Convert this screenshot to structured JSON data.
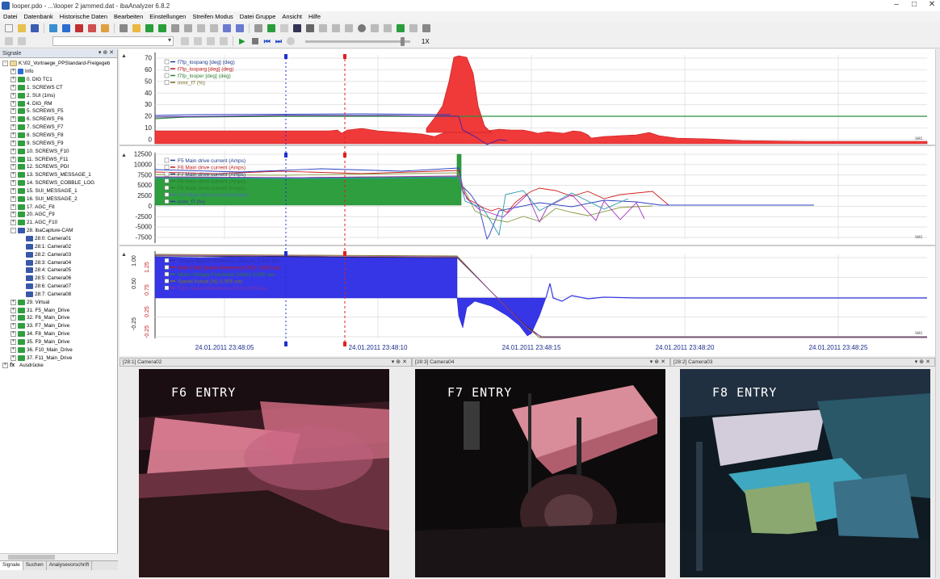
{
  "window": {
    "title": "looper.pdo - ...\\looper 2 jammed.dat - ibaAnalyzer 6.8.2",
    "min_icon": "minimize-icon",
    "max_icon": "maximize-icon",
    "close_icon": "close-icon",
    "min_glyph": "–",
    "max_glyph": "□",
    "close_glyph": "✕"
  },
  "menu": [
    "Datei",
    "Datenbank",
    "Historische Daten",
    "Bearbeiten",
    "Einstellungen",
    "Streifen Modus",
    "Datei Gruppe",
    "Ansicht",
    "Hilfe"
  ],
  "playback": {
    "speed": "1X"
  },
  "signals_panel": {
    "title": "Signale",
    "pin_glyph": "▾ ⊕ ✕",
    "tree": [
      {
        "label": "K:\\02_Vortraege_PPStandard-Freigegeb",
        "level": 0,
        "icon": "file",
        "exp": "-"
      },
      {
        "label": "Info",
        "level": 1,
        "icon": "info",
        "exp": "+"
      },
      {
        "label": "0. DIG TC1",
        "level": 1,
        "icon": "mod",
        "exp": "+"
      },
      {
        "label": "1. SCREWS CT",
        "level": 1,
        "icon": "mod",
        "exp": "+"
      },
      {
        "label": "2. SUI (1ms)",
        "level": 1,
        "icon": "mod",
        "exp": "+"
      },
      {
        "label": "4. DIG_RM",
        "level": 1,
        "icon": "mod",
        "exp": "+"
      },
      {
        "label": "5. SCREWS_F5",
        "level": 1,
        "icon": "mod",
        "exp": "+"
      },
      {
        "label": "6. SCREWS_F6",
        "level": 1,
        "icon": "mod",
        "exp": "+"
      },
      {
        "label": "7. SCREWS_F7",
        "level": 1,
        "icon": "mod",
        "exp": "+"
      },
      {
        "label": "8. SCREWS_F8",
        "level": 1,
        "icon": "mod",
        "exp": "+"
      },
      {
        "label": "9. SCREWS_F9",
        "level": 1,
        "icon": "mod",
        "exp": "+"
      },
      {
        "label": "10. SCREWS_F10",
        "level": 1,
        "icon": "mod",
        "exp": "+"
      },
      {
        "label": "11. SCREWS_F11",
        "level": 1,
        "icon": "mod",
        "exp": "+"
      },
      {
        "label": "12. SCREWS_PDI",
        "level": 1,
        "icon": "mod",
        "exp": "+"
      },
      {
        "label": "13. SCREWS_MESSAGE_1",
        "level": 1,
        "icon": "mod",
        "exp": "+"
      },
      {
        "label": "14. SCREWS_COBBLE_LOG",
        "level": 1,
        "icon": "mod",
        "exp": "+"
      },
      {
        "label": "15. SUI_MESSAGE_1",
        "level": 1,
        "icon": "mod",
        "exp": "+"
      },
      {
        "label": "16. SUI_MESSAGE_2",
        "level": 1,
        "icon": "mod",
        "exp": "+"
      },
      {
        "label": "17. AGC_F8",
        "level": 1,
        "icon": "mod",
        "exp": "+"
      },
      {
        "label": "20. AGC_F9",
        "level": 1,
        "icon": "mod",
        "exp": "+"
      },
      {
        "label": "21. AGC_F10",
        "level": 1,
        "icon": "mod",
        "exp": "+"
      },
      {
        "label": "28. ibaCapture-CAM",
        "level": 1,
        "icon": "cam",
        "exp": "-"
      },
      {
        "label": "28:0: Camera01",
        "level": 2,
        "icon": "cam",
        "exp": ""
      },
      {
        "label": "28:1: Camera02",
        "level": 2,
        "icon": "cam",
        "exp": ""
      },
      {
        "label": "28:2: Camera03",
        "level": 2,
        "icon": "cam",
        "exp": ""
      },
      {
        "label": "28:3: Camera04",
        "level": 2,
        "icon": "cam",
        "exp": ""
      },
      {
        "label": "28:4: Camera05",
        "level": 2,
        "icon": "cam",
        "exp": ""
      },
      {
        "label": "28:5: Camera06",
        "level": 2,
        "icon": "cam",
        "exp": ""
      },
      {
        "label": "28:6: Camera07",
        "level": 2,
        "icon": "cam",
        "exp": ""
      },
      {
        "label": "28:7: Camera08",
        "level": 2,
        "icon": "cam",
        "exp": ""
      },
      {
        "label": "29. Virtual",
        "level": 1,
        "icon": "mod",
        "exp": "+"
      },
      {
        "label": "31. F5_Main_Drive",
        "level": 1,
        "icon": "mod",
        "exp": "+"
      },
      {
        "label": "32. F6_Main_Drive",
        "level": 1,
        "icon": "mod",
        "exp": "+"
      },
      {
        "label": "33. F7_Main_Drive",
        "level": 1,
        "icon": "mod",
        "exp": "+"
      },
      {
        "label": "34. F8_Main_Drive",
        "level": 1,
        "icon": "mod",
        "exp": "+"
      },
      {
        "label": "35. F9_Main_Drive",
        "level": 1,
        "icon": "mod",
        "exp": "+"
      },
      {
        "label": "36. F10_Main_Drive",
        "level": 1,
        "icon": "mod",
        "exp": "+"
      },
      {
        "label": "37. F11_Main_Drive",
        "level": 1,
        "icon": "mod",
        "exp": "+"
      },
      {
        "label": "Ausdrücke",
        "level": 0,
        "icon": "fx",
        "exp": "+"
      }
    ],
    "tabs": [
      "Signale",
      "Suchen",
      "Analysevorschrift"
    ]
  },
  "charts": {
    "chart1": {
      "yticks": [
        "70",
        "60",
        "50",
        "40",
        "30",
        "20",
        "10",
        "0"
      ],
      "legend": [
        "f7fp_loopang [deg] (deg)",
        "f7fp_looparg [deg] (deg)",
        "f7fp_looper [deg] (deg)",
        "mmr_f7 (%)"
      ],
      "unit": "sec"
    },
    "chart2": {
      "yticks": [
        "12500",
        "10000",
        "7500",
        "5000",
        "2500",
        "0",
        "-2500",
        "-5000",
        "-7500"
      ],
      "legend": [
        "F5 Main drive current (Amps)",
        "F6 Main drive current (Amps)",
        "F7 Main drive current (Amps)",
        "F8 Main drive current (Amps)",
        "F9 Main drive current (Amps)",
        "F10 Main drive current (Amps)",
        "mmr_f7 (%)"
      ],
      "unit": "sec"
    },
    "chart3": {
      "yticks_left": [
        "1.00",
        "0.50",
        "-0.25"
      ],
      "yticks_right": [
        "1.25",
        "0.75",
        "0.25",
        "-0.25"
      ],
      "legend": [
        "Torque Speed Reference (Actual) 0.005 sec",
        "Main Field Speed Reference (PU) 0.005 sec",
        "Motor Voltage Feedback (Volts) 0.005 sec",
        "Speed Actual (%) 0.005 sec",
        "Tcho Speed Reference (PU) 0.005 sec"
      ],
      "unit": "sec"
    },
    "time_axis": [
      "24.01.2011 23:48:05",
      "24.01.2011 23:48:10",
      "24.01.2011 23:48:15",
      "24.01.2011 23:48:20",
      "24.01.2011 23:48:25"
    ]
  },
  "cameras": [
    {
      "header": "[28:1] Camera02",
      "overlay": "F6 ENTRY"
    },
    {
      "header": "[28:3] Camera04",
      "overlay": "F7 ENTRY"
    },
    {
      "header": "[28:2] Camera03",
      "overlay": "F8 ENTRY"
    }
  ],
  "colors": {
    "red_fill": "#f03a3a",
    "green_fill": "#2e9e3e",
    "blue_fill": "#3636e6",
    "cursor_blue": "#2030d0",
    "cursor_red": "#e02020",
    "grid": "#d9d9d9"
  }
}
